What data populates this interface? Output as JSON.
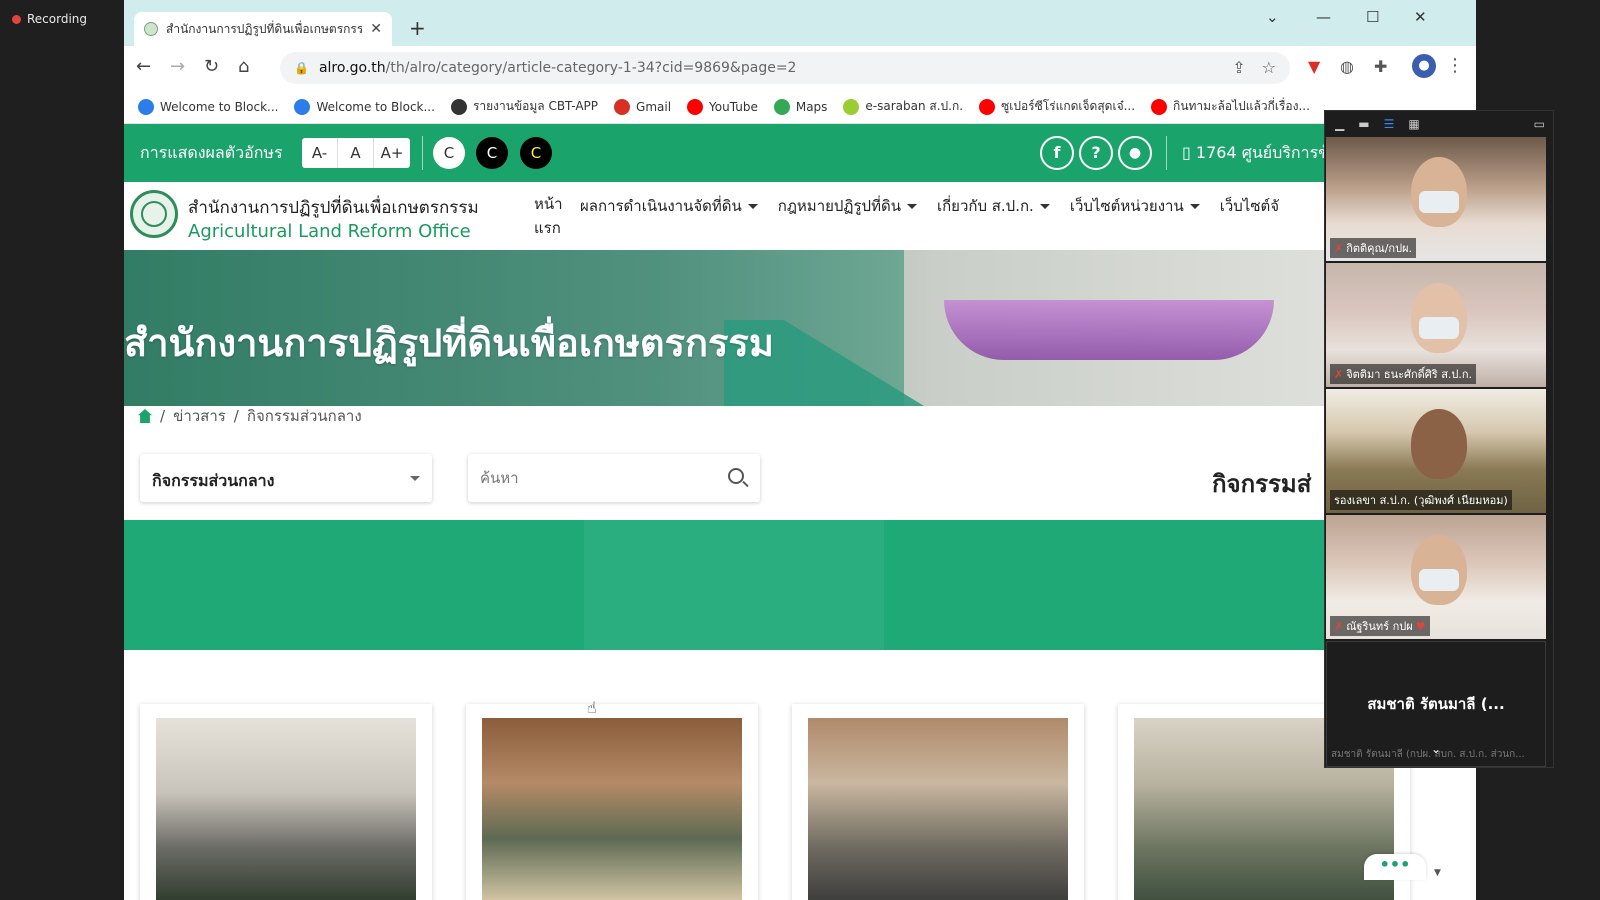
{
  "recording": {
    "label": "Recording"
  },
  "browser": {
    "tab_title": "สำนักงานการปฏิรูปที่ดินเพื่อเกษตรกรรม",
    "new_tab": "+",
    "url_host": "alro.go.th",
    "url_path": "/th/alro/category/article-category-1-34?cid=9869&page=2",
    "bookmarks": [
      {
        "label": "Welcome to Block...",
        "icon": "block-icon",
        "color": "#2b7de9"
      },
      {
        "label": "Welcome to Block...",
        "icon": "block-icon",
        "color": "#2b7de9"
      },
      {
        "label": "รายงานข้อมูล CBT-APP",
        "icon": "globe-icon",
        "color": "#333333"
      },
      {
        "label": "Gmail",
        "icon": "gmail-icon",
        "color": "#d93025"
      },
      {
        "label": "YouTube",
        "icon": "youtube-icon",
        "color": "#ff0000"
      },
      {
        "label": "Maps",
        "icon": "maps-icon",
        "color": "#34a853"
      },
      {
        "label": "e-saraban ส.ป.ก.",
        "icon": "esaraban-icon",
        "color": "#9acd32"
      },
      {
        "label": "ซูเปอร์ซีโร่แกดเจ็ดสุดเจ๋...",
        "icon": "youtube-icon",
        "color": "#ff0000"
      },
      {
        "label": "กินทามะล้อไปแล้วกี่เรื่อง...",
        "icon": "youtube-icon",
        "color": "#ff0000"
      }
    ]
  },
  "site": {
    "access_label": "การแสดงผลตัวอักษร",
    "font_sizes": [
      "A-",
      "A",
      "A+"
    ],
    "contrast": [
      "C",
      "C",
      "C"
    ],
    "social": [
      "f",
      "?",
      ""
    ],
    "hotline": "1764 ศูนย์บริการข้",
    "org_th": "สำนักงานการปฏิรูปที่ดินเพื่อเกษตรกรรม",
    "org_en": "Agricultural Land Reform Office",
    "nav_home": "หน้าแรก",
    "nav": [
      "ผลการดำเนินงานจัดที่ดิน",
      "กฎหมายปฏิรูปที่ดิน",
      "เกี่ยวกับ ส.ป.ก.",
      "เว็บไซต์หน่วยงาน",
      "เว็บไซต์จั"
    ],
    "hero_title": "สำนักงานการปฏิรูปที่ดินเพื่อเกษตรกรรม",
    "breadcrumb": [
      "ข่าวสาร",
      "กิจกรรมส่วนกลาง"
    ],
    "category_select": "กิจกรรมส่วนกลาง",
    "search_placeholder": "ค้นหา",
    "section_title": "กิจกรรมส่",
    "chat_label": "•••"
  },
  "meeting": {
    "participants": [
      {
        "name": "กิตติคุณ/กปผ."
      },
      {
        "name": "จิตติมา ธนะศักดิ์ศิริ ส.ป.ก."
      },
      {
        "name": "รองเลขา ส.ป.ก. (วุฒิพงศ์ เนียมหอม)"
      },
      {
        "name": "ณัฐรินทร์ กปผ"
      }
    ],
    "active_name": "สมชาติ รัตนมาลี (...",
    "active_sub": "สมชาติ รัตนมาลี (กปผ. สบก. ส.ป.ก. ส่วนก..."
  }
}
